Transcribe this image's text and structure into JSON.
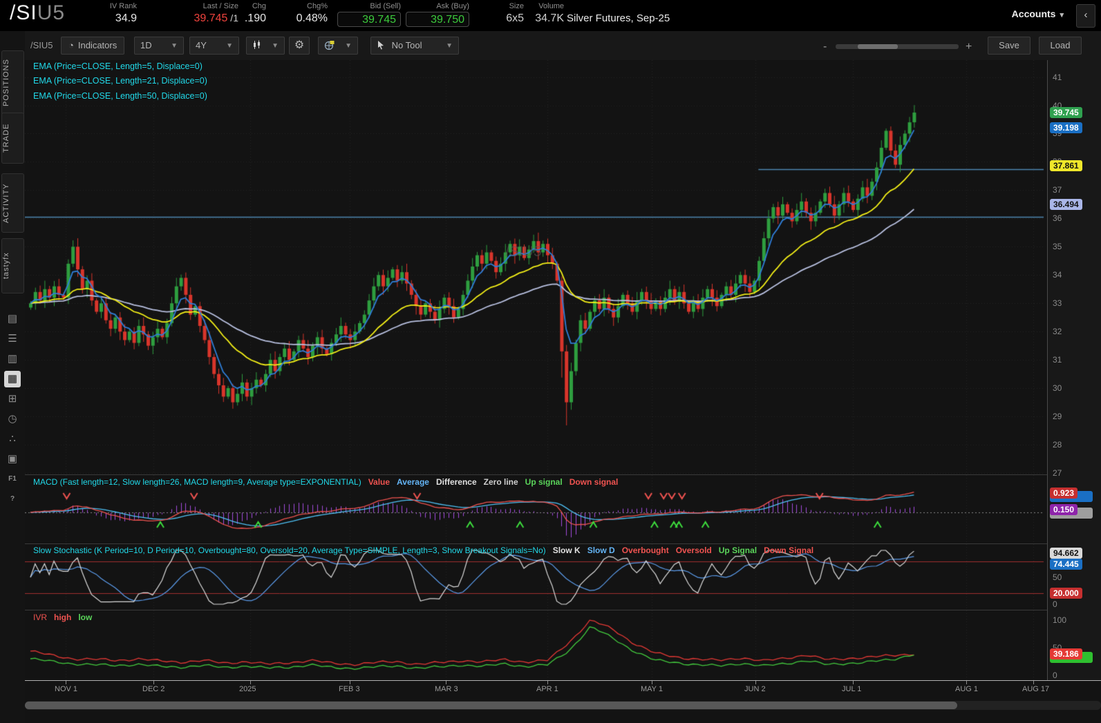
{
  "header": {
    "symbol": "/SI",
    "symbol_suffix": "U5",
    "iv_rank_label": "IV Rank",
    "iv_rank": "34.9",
    "last_label": "Last / Size",
    "last": "39.745",
    "last_size": " /1",
    "chg_label": "Chg",
    "chg": ".190",
    "chgpct_label": "Chg%",
    "chgpct": "0.48%",
    "bid_label": "Bid (Sell)",
    "bid": "39.745",
    "ask_label": "Ask (Buy)",
    "ask": "39.750",
    "size_label": "Size",
    "size": "6x5",
    "volume_label": "Volume",
    "volume": "34.7K",
    "description": "Silver Futures, Sep-25",
    "accounts_label": "Accounts",
    "collapse_glyph": "‹"
  },
  "toolbar": {
    "symbol": "/SIU5",
    "indicators_label": "Indicators",
    "timeframe": "1D",
    "range": "4Y",
    "tool": "No Tool",
    "zoom_minus": "-",
    "zoom_plus": "+",
    "save_label": "Save",
    "load_label": "Load"
  },
  "sidebar": {
    "tabs": [
      {
        "label": "POSITIONS"
      },
      {
        "label": "TRADE"
      },
      {
        "label": "ACTIVITY"
      },
      {
        "label": "tastyfx"
      }
    ],
    "icons": [
      {
        "name": "journal-icon",
        "glyph": "▤"
      },
      {
        "name": "list-icon",
        "glyph": "☰"
      },
      {
        "name": "report-icon",
        "glyph": "▥"
      },
      {
        "name": "chart-icon",
        "glyph": "▦",
        "active": true
      },
      {
        "name": "grid-icon",
        "glyph": "⊞"
      },
      {
        "name": "history-icon",
        "glyph": "◷"
      },
      {
        "name": "contacts-icon",
        "glyph": "∴"
      },
      {
        "name": "calendar-icon",
        "glyph": "▣"
      },
      {
        "name": "f1-key-icon",
        "glyph": "F1",
        "small": true
      },
      {
        "name": "help-icon",
        "glyph": "?",
        "small": true
      }
    ]
  },
  "studies": {
    "ema_labels": [
      "EMA (Price=CLOSE, Length=5, Displace=0)",
      "EMA (Price=CLOSE, Length=21, Displace=0)",
      "EMA (Price=CLOSE, Length=50, Displace=0)"
    ],
    "macd_title": "MACD (Fast length=12, Slow length=26, MACD length=9, Average type=EXPONENTIAL)",
    "macd_legend": [
      {
        "text": "Value",
        "color": "#ef5350"
      },
      {
        "text": "Average",
        "color": "#64b5f6"
      },
      {
        "text": "Difference",
        "color": "#e0e0e0"
      },
      {
        "text": "Zero line",
        "color": "#cfcfcf"
      },
      {
        "text": "Up signal",
        "color": "#5ad45a"
      },
      {
        "text": "Down signal",
        "color": "#ef5350"
      }
    ],
    "stoch_title": "Slow Stochastic (K Period=10, D Period=10, Overbought=80, Oversold=20, Average Type=SIMPLE, Length=3, Show Breakout Signals=No)",
    "stoch_legend": [
      {
        "text": "Slow K",
        "color": "#e0e0e0"
      },
      {
        "text": "Slow D",
        "color": "#64b5f6"
      },
      {
        "text": "Overbought",
        "color": "#ef5350"
      },
      {
        "text": "Oversold",
        "color": "#ef5350"
      },
      {
        "text": "Up Signal",
        "color": "#5ad45a"
      },
      {
        "text": "Down Signal",
        "color": "#ef5350"
      }
    ],
    "ivr_title": "IVR",
    "ivr_legend": [
      {
        "text": "high",
        "color": "#ef5350"
      },
      {
        "text": "low",
        "color": "#5ad45a"
      }
    ]
  },
  "axis_ticks": {
    "main": [
      "41",
      "40",
      "39",
      "38",
      "37",
      "36",
      "35",
      "34",
      "33",
      "32",
      "31",
      "30",
      "29",
      "28",
      "27"
    ],
    "stoch": [
      {
        "label": "50",
        "v": 50
      },
      {
        "label": "0",
        "v": 0
      }
    ],
    "ivr": [
      {
        "label": "100",
        "v": 100
      },
      {
        "label": "50",
        "v": 50
      },
      {
        "label": "0",
        "v": 0
      }
    ]
  },
  "price_bubbles": {
    "main": [
      {
        "text": "39.745",
        "price": 39.745,
        "bg": "#2fa14f",
        "fg": "#ffffff"
      },
      {
        "text": "39.198",
        "price": 39.198,
        "bg": "#1a6fc4",
        "fg": "#ffffff"
      },
      {
        "text": "37.861",
        "price": 37.861,
        "bg": "#efe72a",
        "fg": "#111111"
      },
      {
        "text": "36.494",
        "price": 36.494,
        "bg": "#aab6e8",
        "fg": "#111111"
      }
    ],
    "macd": [
      {
        "text": "",
        "value": 0.76,
        "bg": "#1a6fc4",
        "fg": "#ffffff"
      },
      {
        "text": "",
        "value": -0.02,
        "bg": "#9e9e9e",
        "fg": "#111111"
      },
      {
        "text": "0.923",
        "value": 0.923,
        "bg": "#c62f2f",
        "fg": "#ffffff"
      },
      {
        "text": "0.150",
        "value": 0.15,
        "bg": "#8e24aa",
        "fg": "#ffffff"
      }
    ],
    "stoch": [
      {
        "text": "94.662",
        "value": 94.662,
        "bg": "#d9d9d9",
        "fg": "#111111"
      },
      {
        "text": "74.445",
        "value": 74.445,
        "bg": "#1a6fc4",
        "fg": "#ffffff"
      },
      {
        "text": "20.000",
        "value": 20,
        "bg": "#c62f2f",
        "fg": "#ffffff"
      }
    ],
    "ivr": [
      {
        "text": "",
        "value": 33,
        "bg": "#2fbf2f",
        "fg": "#ffffff"
      },
      {
        "text": "39.186",
        "value": 39.186,
        "bg": "#e53935",
        "fg": "#ffffff"
      }
    ]
  },
  "dates": [
    {
      "label": "NOV 1",
      "f": 0.04
    },
    {
      "label": "DEC 2",
      "f": 0.126
    },
    {
      "label": "2025",
      "f": 0.221
    },
    {
      "label": "FEB 3",
      "f": 0.319
    },
    {
      "label": "MAR 3",
      "f": 0.413
    },
    {
      "label": "APR 1",
      "f": 0.513
    },
    {
      "label": "MAY 1",
      "f": 0.615
    },
    {
      "label": "JUN 2",
      "f": 0.717
    },
    {
      "label": "JUL 1",
      "f": 0.813
    },
    {
      "label": "AUG 1",
      "f": 0.924
    },
    {
      "label": "AUG 17",
      "f": 0.99
    }
  ],
  "chart_data": {
    "type": "candlestick",
    "symbol": "/SIU5",
    "watermark": "/SIU5",
    "ylim": [
      26.95,
      41.6
    ],
    "x0": 8,
    "dx": 6.8,
    "closes": [
      33.0,
      33.4,
      33.1,
      33.5,
      33.2,
      33.6,
      33.3,
      33.2,
      34.4,
      35.0,
      34.2,
      33.5,
      33.8,
      33.1,
      32.7,
      33.0,
      32.4,
      32.1,
      32.5,
      32.0,
      31.7,
      32.0,
      31.6,
      32.2,
      31.9,
      31.5,
      31.8,
      32.1,
      31.8,
      32.3,
      33.0,
      33.6,
      33.9,
      33.3,
      32.6,
      32.9,
      32.2,
      31.7,
      31.1,
      30.5,
      30.1,
      29.7,
      30.0,
      29.5,
      29.8,
      30.2,
      29.7,
      30.0,
      30.3,
      30.1,
      30.5,
      31.0,
      30.6,
      31.1,
      31.4,
      31.0,
      31.3,
      31.7,
      31.4,
      31.1,
      31.5,
      31.8,
      31.4,
      31.2,
      31.6,
      31.9,
      32.2,
      31.9,
      31.7,
      32.0,
      32.3,
      32.6,
      33.1,
      33.6,
      34.0,
      33.6,
      33.9,
      34.2,
      33.8,
      34.1,
      33.7,
      33.3,
      32.9,
      32.6,
      33.0,
      32.7,
      32.4,
      32.8,
      33.2,
      32.9,
      32.5,
      32.8,
      33.3,
      33.8,
      34.3,
      34.7,
      34.4,
      34.8,
      34.5,
      34.1,
      34.4,
      34.8,
      35.1,
      34.7,
      35.0,
      34.6,
      34.9,
      35.2,
      34.8,
      35.1,
      34.7,
      34.4,
      33.8,
      31.3,
      29.5,
      30.6,
      31.6,
      32.4,
      32.1,
      32.7,
      33.1,
      32.8,
      33.2,
      32.8,
      32.5,
      32.9,
      33.3,
      33.0,
      32.7,
      33.1,
      33.4,
      33.1,
      32.8,
      33.1,
      32.8,
      33.2,
      33.5,
      33.1,
      33.4,
      33.0,
      32.7,
      33.1,
      32.8,
      33.2,
      33.5,
      33.2,
      32.9,
      33.3,
      33.6,
      33.3,
      33.7,
      34.0,
      33.7,
      33.4,
      33.8,
      34.5,
      35.3,
      36.0,
      36.4,
      36.1,
      36.5,
      36.2,
      35.9,
      36.3,
      36.6,
      36.2,
      35.9,
      36.2,
      36.6,
      36.9,
      36.5,
      36.1,
      36.5,
      36.9,
      36.6,
      36.3,
      36.7,
      37.1,
      36.8,
      37.3,
      37.8,
      38.5,
      39.1,
      38.4,
      37.9,
      38.6,
      39.0,
      39.4,
      39.745
    ],
    "ema_lengths": [
      5,
      21,
      50
    ],
    "hlines": [
      {
        "price": 36.05,
        "from": 0.0
      },
      {
        "price": 37.75,
        "from": 0.72
      }
    ],
    "macd": {
      "fast": 12,
      "slow": 26,
      "signal": 9,
      "ylim": [
        -1.5,
        1.8
      ]
    },
    "macd_signals": {
      "down": [
        0.041,
        0.166,
        0.385,
        0.612,
        0.627,
        0.635,
        0.645,
        0.78
      ],
      "up": [
        0.133,
        0.229,
        0.437,
        0.486,
        0.558,
        0.618,
        0.637,
        0.642,
        0.668,
        0.837
      ]
    },
    "stoch": {
      "k_period": 10,
      "smooth": 3,
      "d_period": 10,
      "overbought": 80,
      "oversold": 20
    },
    "ivr": {
      "ylim": [
        0,
        105
      ],
      "high": [
        44,
        36,
        30,
        29,
        27,
        30,
        26,
        24,
        27,
        22,
        25,
        20,
        23,
        27,
        22,
        20,
        23,
        25,
        20,
        23,
        27,
        24,
        29,
        24,
        27,
        60,
        100,
        84,
        58,
        40,
        33,
        29,
        27,
        32,
        26,
        31,
        37,
        28,
        31,
        33,
        36,
        39.2
      ],
      "low": [
        30,
        25,
        21,
        19,
        18,
        20,
        16,
        15,
        18,
        14,
        17,
        13,
        15,
        19,
        14,
        13,
        15,
        17,
        13,
        15,
        19,
        16,
        21,
        16,
        19,
        45,
        88,
        68,
        44,
        27,
        23,
        19,
        17,
        22,
        17,
        21,
        27,
        19,
        22,
        25,
        28,
        38.9
      ]
    },
    "colors": {
      "up": "#2e9e3f",
      "down": "#d8352b",
      "ema5": "#2f7ed8",
      "ema21": "#f2ee17",
      "ema50": "#b8c0e0",
      "hline": "#4d87b0",
      "macd_value": "#ef5350",
      "macd_avg": "#4fc3f7",
      "hist": "#a64ce0",
      "stoch_k": "#dddddd",
      "stoch_d": "#5c9ded",
      "ob_os": "#a33030",
      "ivr_high": "#e53935",
      "ivr_low": "#43cb3e"
    }
  }
}
